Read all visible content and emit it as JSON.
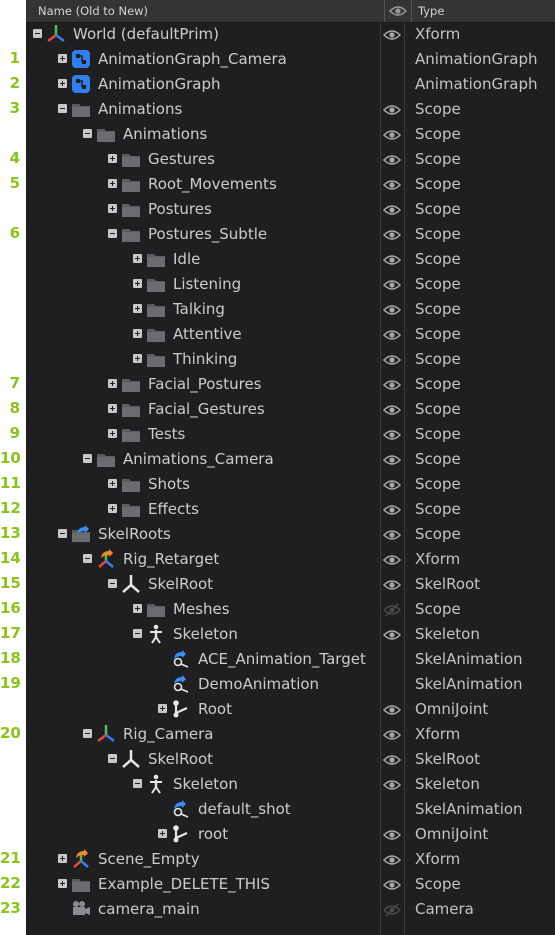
{
  "header": {
    "name_label": "Name (Old to New)",
    "type_label": "Type"
  },
  "rows": [
    {
      "num": "",
      "label": "World (defaultPrim)",
      "type": "Xform",
      "depth": 0,
      "exp": "minus",
      "icon": "xform-icon",
      "eye": "visible"
    },
    {
      "num": "1",
      "label": "AnimationGraph_Camera",
      "type": "AnimationGraph",
      "depth": 1,
      "exp": "plus",
      "icon": "animation-graph-icon",
      "eye": "none"
    },
    {
      "num": "2",
      "label": "AnimationGraph",
      "type": "AnimationGraph",
      "depth": 1,
      "exp": "plus",
      "icon": "animation-graph-icon",
      "eye": "none"
    },
    {
      "num": "3",
      "label": "Animations",
      "type": "Scope",
      "depth": 1,
      "exp": "minus",
      "icon": "folder-icon",
      "eye": "visible"
    },
    {
      "num": "",
      "label": "Animations",
      "type": "Scope",
      "depth": 2,
      "exp": "minus",
      "icon": "folder-icon",
      "eye": "visible"
    },
    {
      "num": "4",
      "label": "Gestures",
      "type": "Scope",
      "depth": 3,
      "exp": "plus",
      "icon": "folder-icon",
      "eye": "visible"
    },
    {
      "num": "5",
      "label": "Root_Movements",
      "type": "Scope",
      "depth": 3,
      "exp": "plus",
      "icon": "folder-icon",
      "eye": "visible"
    },
    {
      "num": "",
      "label": "Postures",
      "type": "Scope",
      "depth": 3,
      "exp": "plus",
      "icon": "folder-icon",
      "eye": "visible"
    },
    {
      "num": "6",
      "label": "Postures_Subtle",
      "type": "Scope",
      "depth": 3,
      "exp": "minus",
      "icon": "folder-icon",
      "eye": "visible"
    },
    {
      "num": "",
      "label": "Idle",
      "type": "Scope",
      "depth": 4,
      "exp": "plus",
      "icon": "folder-icon",
      "eye": "visible"
    },
    {
      "num": "",
      "label": "Listening",
      "type": "Scope",
      "depth": 4,
      "exp": "plus",
      "icon": "folder-icon",
      "eye": "visible"
    },
    {
      "num": "",
      "label": "Talking",
      "type": "Scope",
      "depth": 4,
      "exp": "plus",
      "icon": "folder-icon",
      "eye": "visible"
    },
    {
      "num": "",
      "label": "Attentive",
      "type": "Scope",
      "depth": 4,
      "exp": "plus",
      "icon": "folder-icon",
      "eye": "visible"
    },
    {
      "num": "",
      "label": "Thinking",
      "type": "Scope",
      "depth": 4,
      "exp": "plus",
      "icon": "folder-icon",
      "eye": "visible"
    },
    {
      "num": "7",
      "label": "Facial_Postures",
      "type": "Scope",
      "depth": 3,
      "exp": "plus",
      "icon": "folder-icon",
      "eye": "visible"
    },
    {
      "num": "8",
      "label": "Facial_Gestures",
      "type": "Scope",
      "depth": 3,
      "exp": "plus",
      "icon": "folder-icon",
      "eye": "visible"
    },
    {
      "num": "9",
      "label": "Tests",
      "type": "Scope",
      "depth": 3,
      "exp": "plus",
      "icon": "folder-icon",
      "eye": "visible"
    },
    {
      "num": "10",
      "label": "Animations_Camera",
      "type": "Scope",
      "depth": 2,
      "exp": "minus",
      "icon": "folder-icon",
      "eye": "visible"
    },
    {
      "num": "11",
      "label": "Shots",
      "type": "Scope",
      "depth": 3,
      "exp": "plus",
      "icon": "folder-icon",
      "eye": "visible"
    },
    {
      "num": "12",
      "label": "Effects",
      "type": "Scope",
      "depth": 3,
      "exp": "plus",
      "icon": "folder-icon",
      "eye": "visible"
    },
    {
      "num": "13",
      "label": "SkelRoots",
      "type": "Scope",
      "depth": 1,
      "exp": "minus",
      "icon": "folder-arrow-icon",
      "eye": "visible"
    },
    {
      "num": "14",
      "label": "Rig_Retarget",
      "type": "Xform",
      "depth": 2,
      "exp": "minus",
      "icon": "xform-arrow-icon",
      "eye": "visible"
    },
    {
      "num": "15",
      "label": "SkelRoot",
      "type": "SkelRoot",
      "depth": 3,
      "exp": "minus",
      "icon": "skelroot-icon",
      "eye": "visible"
    },
    {
      "num": "16",
      "label": "Meshes",
      "type": "Scope",
      "depth": 4,
      "exp": "plus",
      "icon": "folder-icon",
      "eye": "hidden"
    },
    {
      "num": "17",
      "label": "Skeleton",
      "type": "Skeleton",
      "depth": 4,
      "exp": "minus",
      "icon": "skeleton-icon",
      "eye": "visible"
    },
    {
      "num": "18",
      "label": "ACE_Animation_Target",
      "type": "SkelAnimation",
      "depth": 5,
      "exp": "",
      "icon": "skel-animation-icon",
      "eye": "none"
    },
    {
      "num": "19",
      "label": "DemoAnimation",
      "type": "SkelAnimation",
      "depth": 5,
      "exp": "",
      "icon": "skel-animation-icon",
      "eye": "none"
    },
    {
      "num": "",
      "label": "Root",
      "type": "OmniJoint",
      "depth": 5,
      "exp": "plus",
      "icon": "joint-icon",
      "eye": "visible"
    },
    {
      "num": "20",
      "label": "Rig_Camera",
      "type": "Xform",
      "depth": 2,
      "exp": "minus",
      "icon": "xform-icon",
      "eye": "visible"
    },
    {
      "num": "",
      "label": "SkelRoot",
      "type": "SkelRoot",
      "depth": 3,
      "exp": "minus",
      "icon": "skelroot-icon",
      "eye": "visible"
    },
    {
      "num": "",
      "label": "Skeleton",
      "type": "Skeleton",
      "depth": 4,
      "exp": "minus",
      "icon": "skeleton-icon",
      "eye": "visible"
    },
    {
      "num": "",
      "label": "default_shot",
      "type": "SkelAnimation",
      "depth": 5,
      "exp": "",
      "icon": "skel-animation-icon",
      "eye": "none"
    },
    {
      "num": "",
      "label": "root",
      "type": "OmniJoint",
      "depth": 5,
      "exp": "plus",
      "icon": "joint-icon",
      "eye": "visible"
    },
    {
      "num": "21",
      "label": "Scene_Empty",
      "type": "Xform",
      "depth": 1,
      "exp": "plus",
      "icon": "xform-arrow-icon",
      "eye": "visible"
    },
    {
      "num": "22",
      "label": "Example_DELETE_THIS",
      "type": "Scope",
      "depth": 1,
      "exp": "plus",
      "icon": "folder-icon",
      "eye": "visible"
    },
    {
      "num": "23",
      "label": "camera_main",
      "type": "Camera",
      "depth": 1,
      "exp": "",
      "icon": "camera-icon",
      "eye": "hidden"
    }
  ]
}
